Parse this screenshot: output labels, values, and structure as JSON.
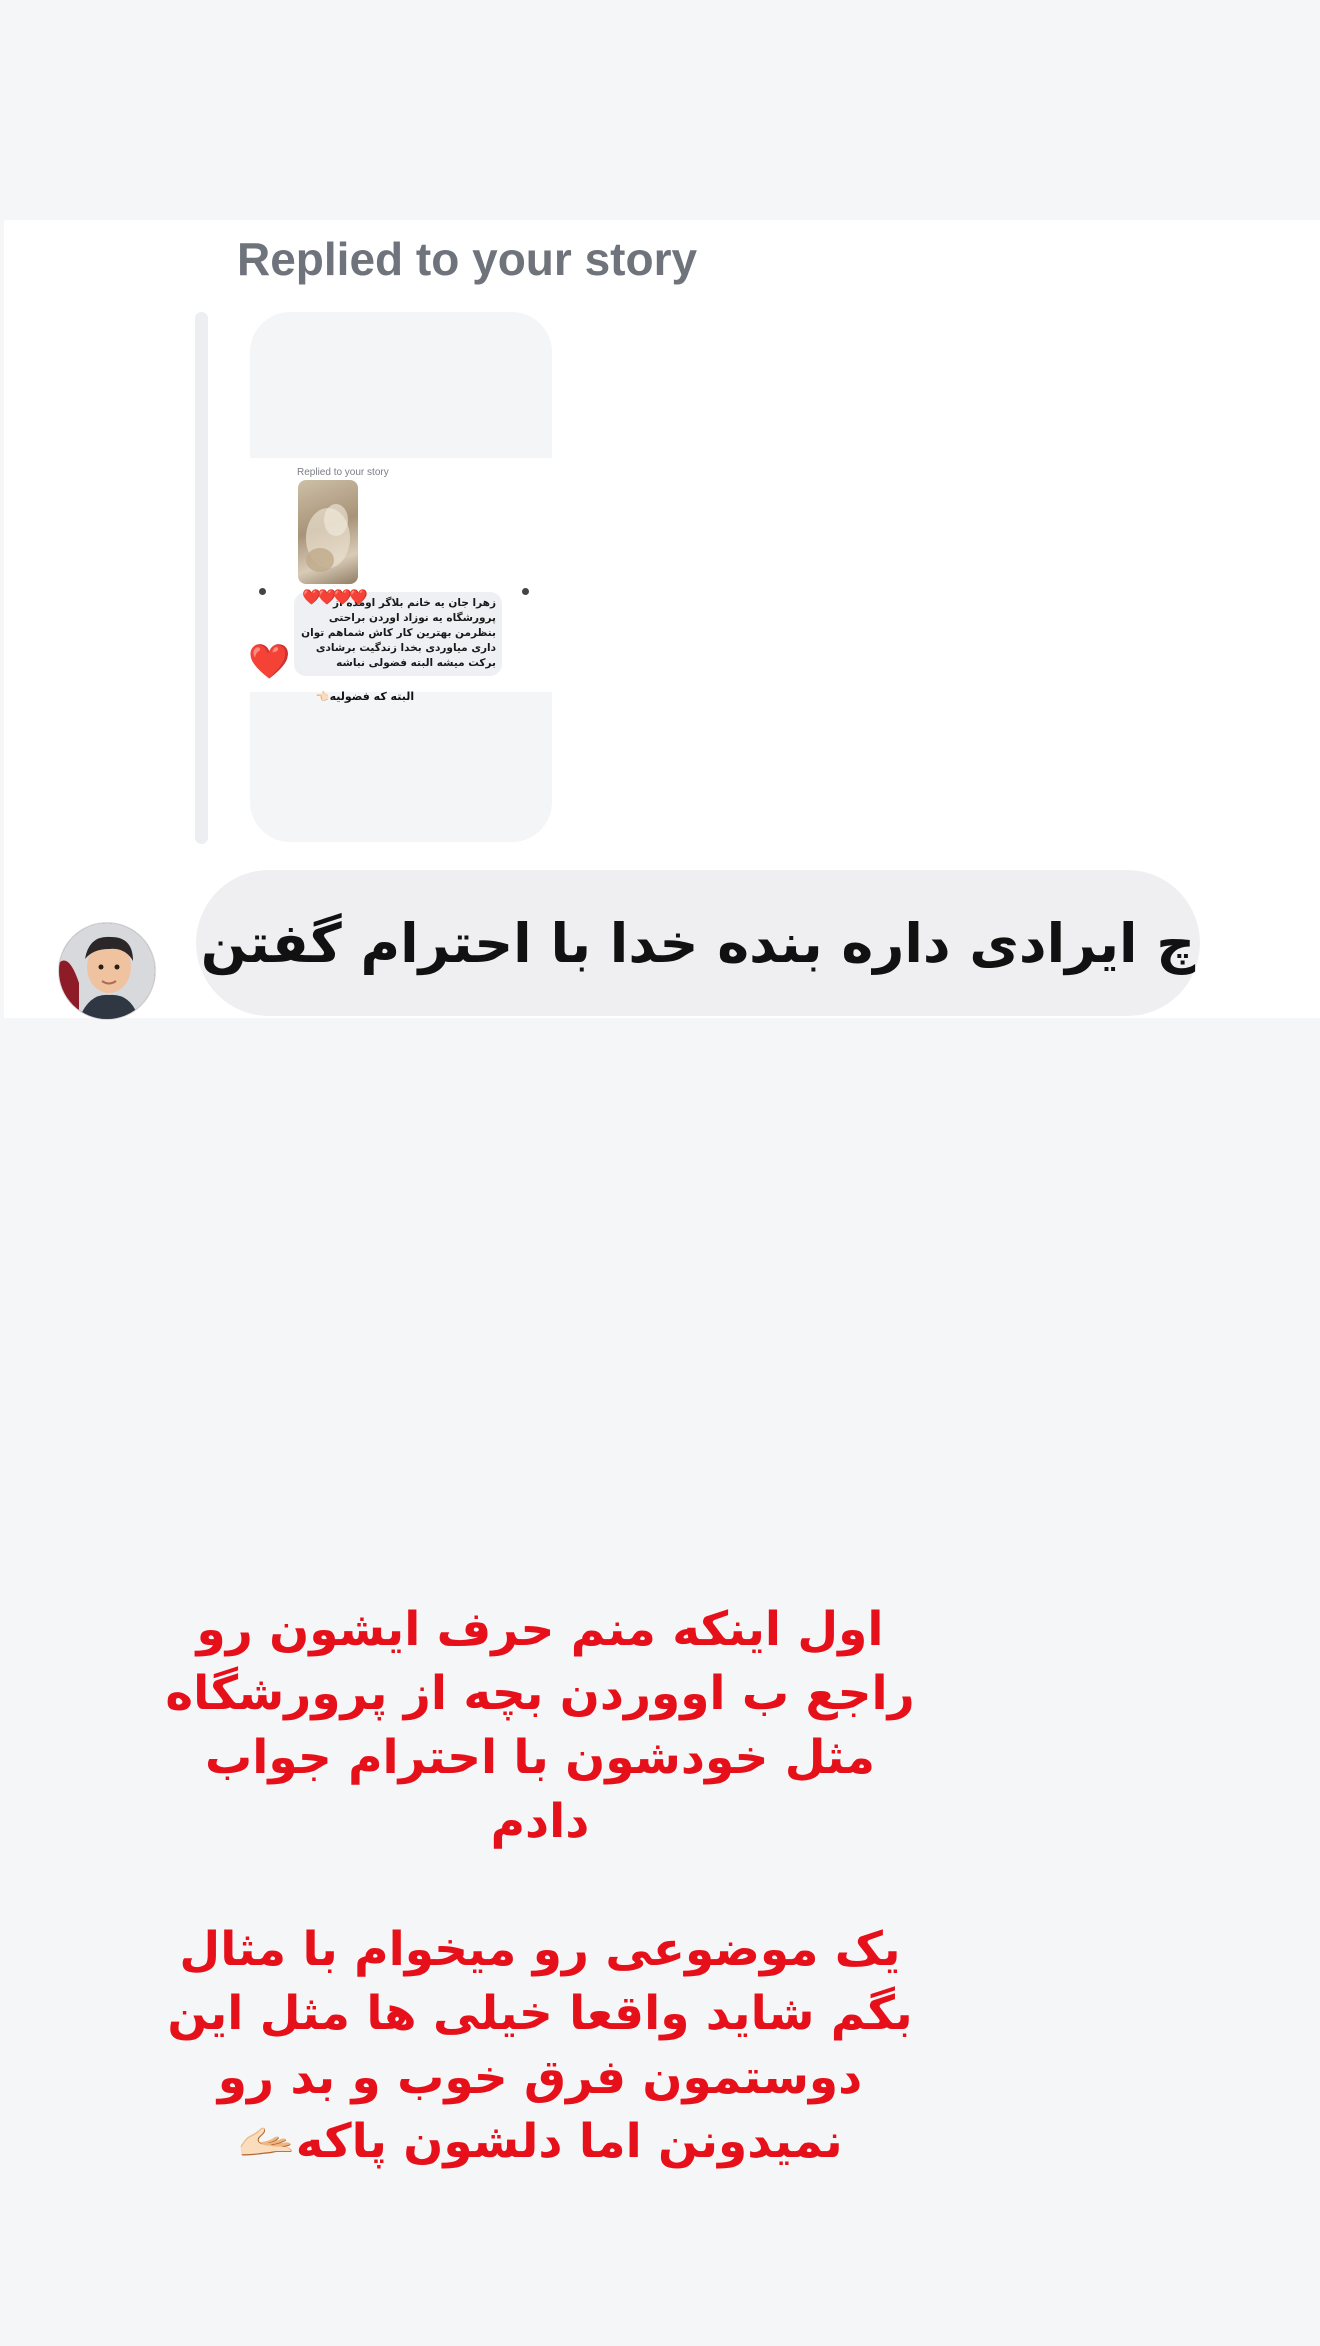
{
  "reply": {
    "label": "Replied to your story"
  },
  "story_preview": {
    "inner_label": "Replied to your story",
    "hearts": "❤️❤️❤️❤️",
    "comment_text": "زهرا جان یه خانم بلاگر اومده از پرورشگاه یه نوزاد اوردن براحتی بنظرمن بهترین کار کاش شماهم توان داری میاوردی بخدا زندگیت برشادی برکت میشه البته فضولی نباشه",
    "heart": "❤️",
    "reply_text": "البته که فضولیه👈🏻"
  },
  "message": {
    "text": "چ ایرادی داره بنده خدا با احترام گفتن"
  },
  "caption": {
    "paragraph1": [
      "اول اینکه منم حرف ایشون رو",
      "راجع ب اووردن بچه از پرورشگاه",
      "مثل خودشون با احترام جواب",
      "دادم"
    ],
    "paragraph2": [
      "یک موضوعی رو میخوام با مثال",
      "بگم شاید واقعا خیلی ها مثل این",
      "دوستمون فرق خوب و بد رو",
      "نمیدونن اما دلشون پاکه🫴🏻"
    ]
  },
  "colors": {
    "caption_red": "#e6101a",
    "bubble_gray": "#efeff1",
    "label_gray": "#6f737b"
  }
}
